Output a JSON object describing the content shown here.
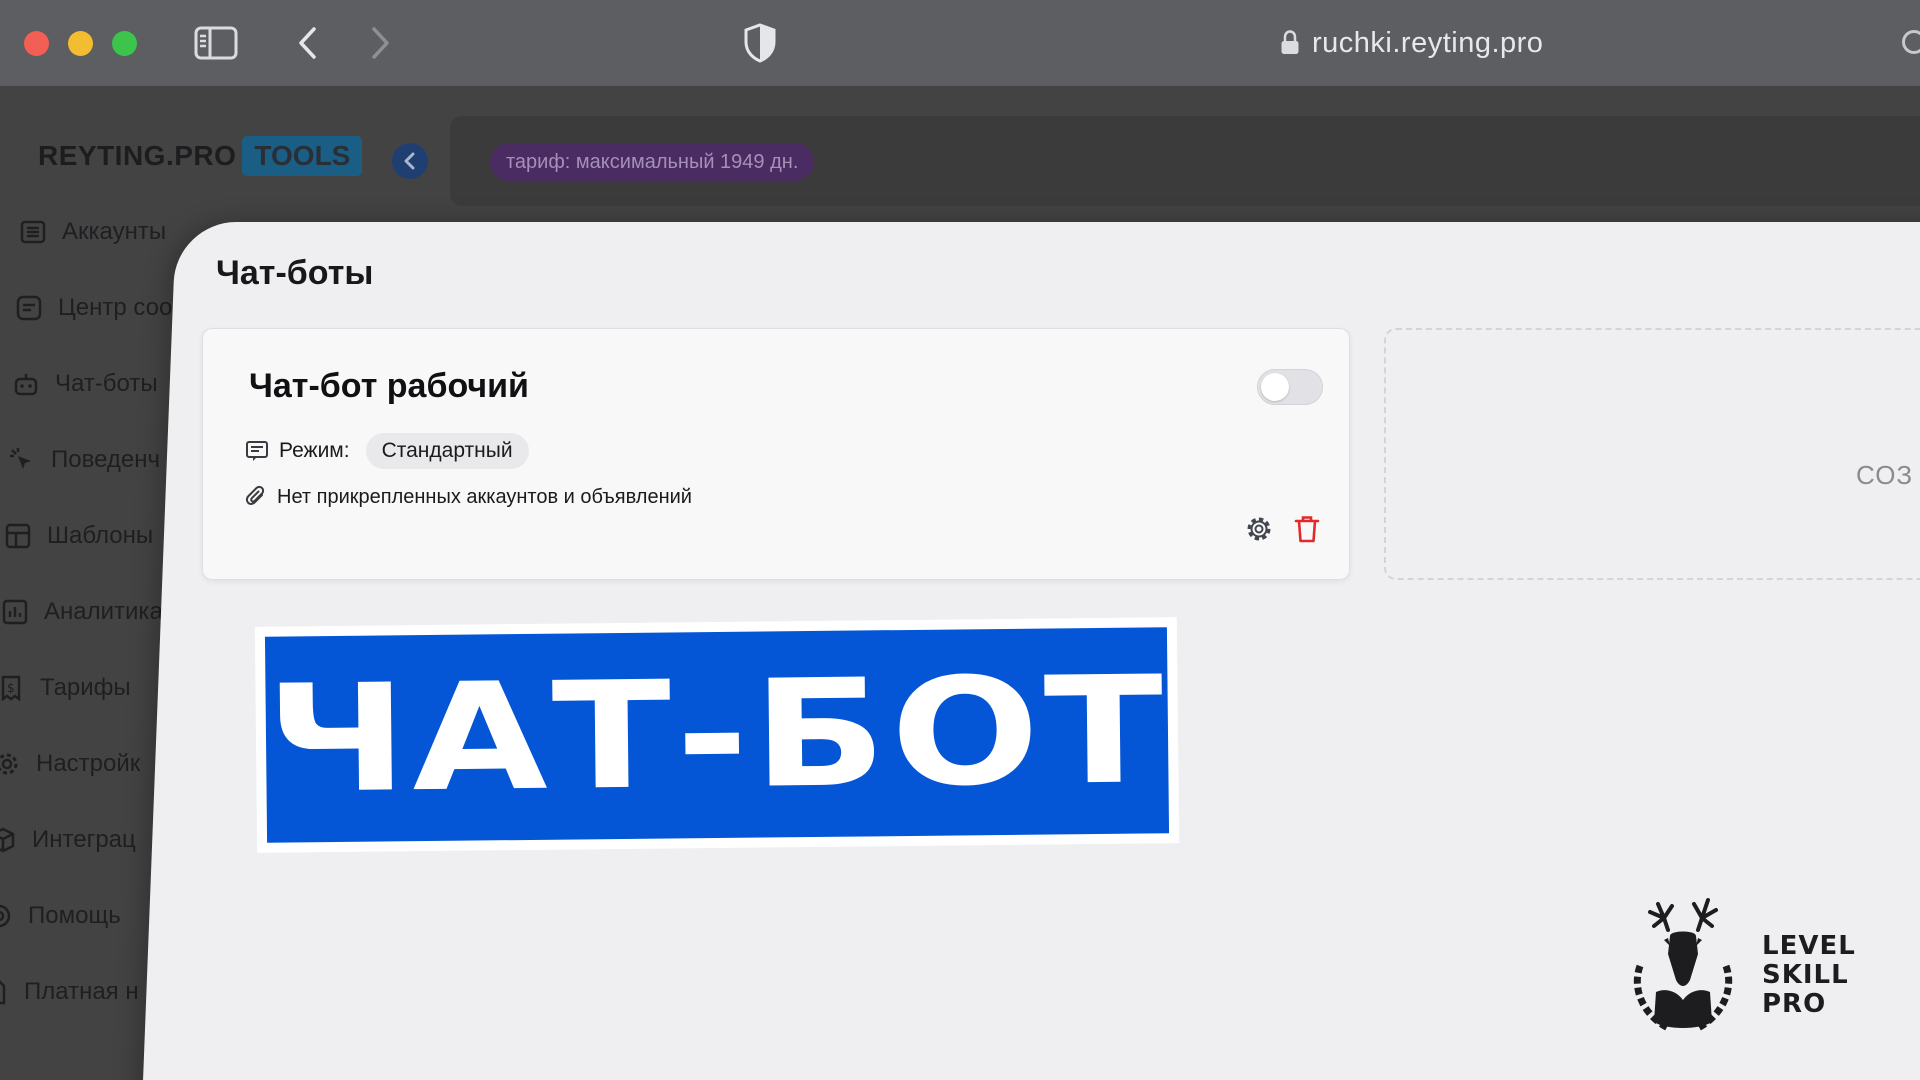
{
  "browser": {
    "address": "ruchki.reyting.pro",
    "icons": [
      "sidebar-icon",
      "back-icon",
      "forward-icon",
      "shield-icon",
      "lock-icon"
    ]
  },
  "app": {
    "brand": "REYTING.PRO",
    "brand_tag": "TOOLS",
    "tariff_badge": "тариф: максимальный 1949 дн.",
    "nav": [
      {
        "label": "Аккаунты",
        "icon": "list-icon"
      },
      {
        "label": "Центр соо",
        "icon": "message-icon"
      },
      {
        "label": "Чат-боты",
        "icon": "bot-icon"
      },
      {
        "label": "Поведенч",
        "icon": "cursor-click-icon"
      },
      {
        "label": "Шаблоны",
        "icon": "template-icon"
      },
      {
        "label": "Аналитика",
        "icon": "chart-icon"
      },
      {
        "label": "Тарифы",
        "icon": "receipt-icon"
      },
      {
        "label": "Настройк",
        "icon": "gear-icon"
      },
      {
        "label": "Интеграц",
        "icon": "cube-icon"
      },
      {
        "label": "Помощь",
        "icon": "help-icon"
      },
      {
        "label": "Платная н",
        "icon": "file-icon"
      }
    ]
  },
  "page": {
    "title": "Чат-боты",
    "bot_card": {
      "title": "Чат-бот рабочий",
      "enabled": false,
      "mode_label": "Режим:",
      "mode_value": "Стандартный",
      "attachments_text": "Нет прикрепленных аккаунтов и объявлений"
    },
    "create_card_text": "СОЗ"
  },
  "overlay": {
    "banner_text": "ЧАТ-БОТ",
    "banner_color": "#0456d6"
  },
  "logo": {
    "line1": "LEVEL",
    "line2": "SKILL",
    "line3": "PRO"
  }
}
